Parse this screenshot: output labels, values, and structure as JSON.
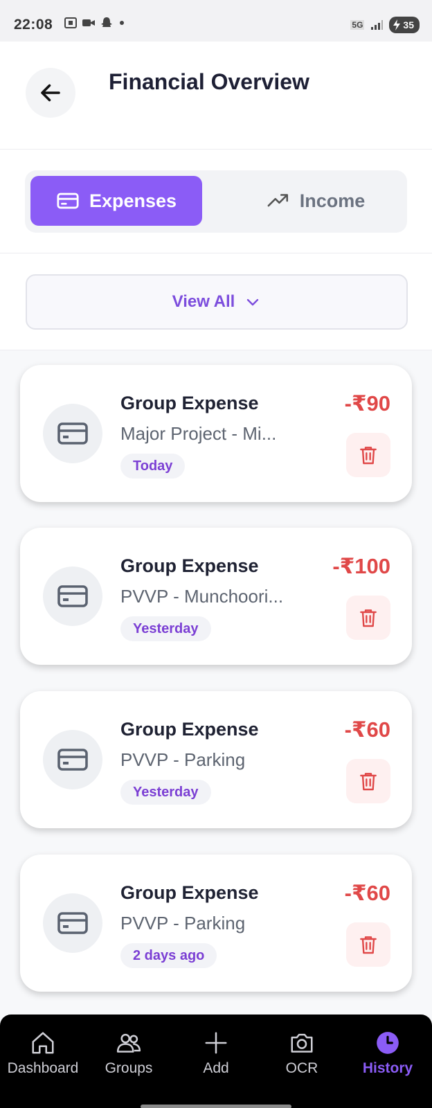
{
  "status_bar": {
    "time": "22:08",
    "network": "5G",
    "battery": "35"
  },
  "header": {
    "title": "Financial Overview"
  },
  "tabs": [
    {
      "label": "Expenses",
      "active": true,
      "icon": "credit-card-icon"
    },
    {
      "label": "Income",
      "active": false,
      "icon": "trending-up-icon"
    }
  ],
  "filter": {
    "label": "View All",
    "icon": "chevron-down-icon"
  },
  "transactions": [
    {
      "title": "Group Expense",
      "subtitle": "Major Project - Mi...",
      "date": "Today",
      "amount": "-₹90"
    },
    {
      "title": "Group Expense",
      "subtitle": "PVVP - Munchoori...",
      "date": "Yesterday",
      "amount": "-₹100"
    },
    {
      "title": "Group Expense",
      "subtitle": "PVVP - Parking",
      "date": "Yesterday",
      "amount": "-₹60"
    },
    {
      "title": "Group Expense",
      "subtitle": "PVVP - Parking",
      "date": "2 days ago",
      "amount": "-₹60"
    }
  ],
  "bottom_nav": [
    {
      "label": "Dashboard",
      "icon": "home-icon",
      "active": false
    },
    {
      "label": "Groups",
      "icon": "users-icon",
      "active": false
    },
    {
      "label": "Add",
      "icon": "plus-icon",
      "active": false
    },
    {
      "label": "OCR",
      "icon": "camera-icon",
      "active": false
    },
    {
      "label": "History",
      "icon": "clock-icon",
      "active": true
    }
  ],
  "colors": {
    "accent": "#8b5cf6",
    "expense_red": "#e04848",
    "badge_text": "#7b3fd4",
    "nav_bg": "#000000"
  }
}
